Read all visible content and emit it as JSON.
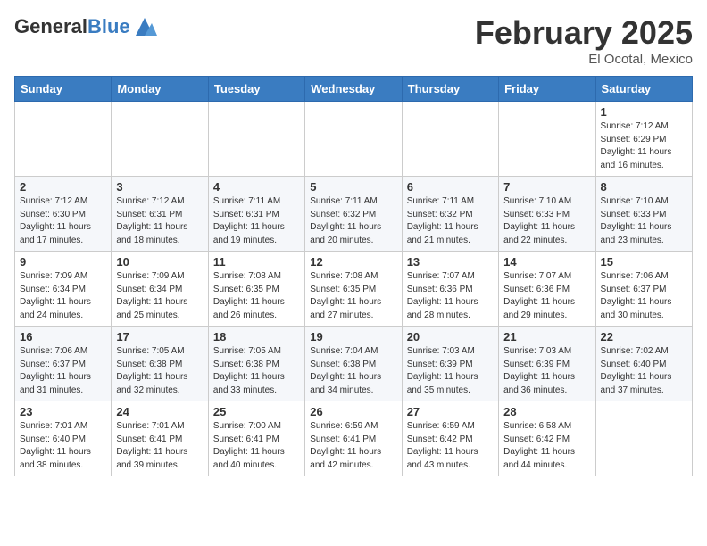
{
  "header": {
    "logo_general": "General",
    "logo_blue": "Blue",
    "month_title": "February 2025",
    "location": "El Ocotal, Mexico"
  },
  "weekdays": [
    "Sunday",
    "Monday",
    "Tuesday",
    "Wednesday",
    "Thursday",
    "Friday",
    "Saturday"
  ],
  "weeks": [
    [
      {
        "day": "",
        "info": ""
      },
      {
        "day": "",
        "info": ""
      },
      {
        "day": "",
        "info": ""
      },
      {
        "day": "",
        "info": ""
      },
      {
        "day": "",
        "info": ""
      },
      {
        "day": "",
        "info": ""
      },
      {
        "day": "1",
        "info": "Sunrise: 7:12 AM\nSunset: 6:29 PM\nDaylight: 11 hours\nand 16 minutes."
      }
    ],
    [
      {
        "day": "2",
        "info": "Sunrise: 7:12 AM\nSunset: 6:30 PM\nDaylight: 11 hours\nand 17 minutes."
      },
      {
        "day": "3",
        "info": "Sunrise: 7:12 AM\nSunset: 6:31 PM\nDaylight: 11 hours\nand 18 minutes."
      },
      {
        "day": "4",
        "info": "Sunrise: 7:11 AM\nSunset: 6:31 PM\nDaylight: 11 hours\nand 19 minutes."
      },
      {
        "day": "5",
        "info": "Sunrise: 7:11 AM\nSunset: 6:32 PM\nDaylight: 11 hours\nand 20 minutes."
      },
      {
        "day": "6",
        "info": "Sunrise: 7:11 AM\nSunset: 6:32 PM\nDaylight: 11 hours\nand 21 minutes."
      },
      {
        "day": "7",
        "info": "Sunrise: 7:10 AM\nSunset: 6:33 PM\nDaylight: 11 hours\nand 22 minutes."
      },
      {
        "day": "8",
        "info": "Sunrise: 7:10 AM\nSunset: 6:33 PM\nDaylight: 11 hours\nand 23 minutes."
      }
    ],
    [
      {
        "day": "9",
        "info": "Sunrise: 7:09 AM\nSunset: 6:34 PM\nDaylight: 11 hours\nand 24 minutes."
      },
      {
        "day": "10",
        "info": "Sunrise: 7:09 AM\nSunset: 6:34 PM\nDaylight: 11 hours\nand 25 minutes."
      },
      {
        "day": "11",
        "info": "Sunrise: 7:08 AM\nSunset: 6:35 PM\nDaylight: 11 hours\nand 26 minutes."
      },
      {
        "day": "12",
        "info": "Sunrise: 7:08 AM\nSunset: 6:35 PM\nDaylight: 11 hours\nand 27 minutes."
      },
      {
        "day": "13",
        "info": "Sunrise: 7:07 AM\nSunset: 6:36 PM\nDaylight: 11 hours\nand 28 minutes."
      },
      {
        "day": "14",
        "info": "Sunrise: 7:07 AM\nSunset: 6:36 PM\nDaylight: 11 hours\nand 29 minutes."
      },
      {
        "day": "15",
        "info": "Sunrise: 7:06 AM\nSunset: 6:37 PM\nDaylight: 11 hours\nand 30 minutes."
      }
    ],
    [
      {
        "day": "16",
        "info": "Sunrise: 7:06 AM\nSunset: 6:37 PM\nDaylight: 11 hours\nand 31 minutes."
      },
      {
        "day": "17",
        "info": "Sunrise: 7:05 AM\nSunset: 6:38 PM\nDaylight: 11 hours\nand 32 minutes."
      },
      {
        "day": "18",
        "info": "Sunrise: 7:05 AM\nSunset: 6:38 PM\nDaylight: 11 hours\nand 33 minutes."
      },
      {
        "day": "19",
        "info": "Sunrise: 7:04 AM\nSunset: 6:38 PM\nDaylight: 11 hours\nand 34 minutes."
      },
      {
        "day": "20",
        "info": "Sunrise: 7:03 AM\nSunset: 6:39 PM\nDaylight: 11 hours\nand 35 minutes."
      },
      {
        "day": "21",
        "info": "Sunrise: 7:03 AM\nSunset: 6:39 PM\nDaylight: 11 hours\nand 36 minutes."
      },
      {
        "day": "22",
        "info": "Sunrise: 7:02 AM\nSunset: 6:40 PM\nDaylight: 11 hours\nand 37 minutes."
      }
    ],
    [
      {
        "day": "23",
        "info": "Sunrise: 7:01 AM\nSunset: 6:40 PM\nDaylight: 11 hours\nand 38 minutes."
      },
      {
        "day": "24",
        "info": "Sunrise: 7:01 AM\nSunset: 6:41 PM\nDaylight: 11 hours\nand 39 minutes."
      },
      {
        "day": "25",
        "info": "Sunrise: 7:00 AM\nSunset: 6:41 PM\nDaylight: 11 hours\nand 40 minutes."
      },
      {
        "day": "26",
        "info": "Sunrise: 6:59 AM\nSunset: 6:41 PM\nDaylight: 11 hours\nand 42 minutes."
      },
      {
        "day": "27",
        "info": "Sunrise: 6:59 AM\nSunset: 6:42 PM\nDaylight: 11 hours\nand 43 minutes."
      },
      {
        "day": "28",
        "info": "Sunrise: 6:58 AM\nSunset: 6:42 PM\nDaylight: 11 hours\nand 44 minutes."
      },
      {
        "day": "",
        "info": ""
      }
    ]
  ]
}
